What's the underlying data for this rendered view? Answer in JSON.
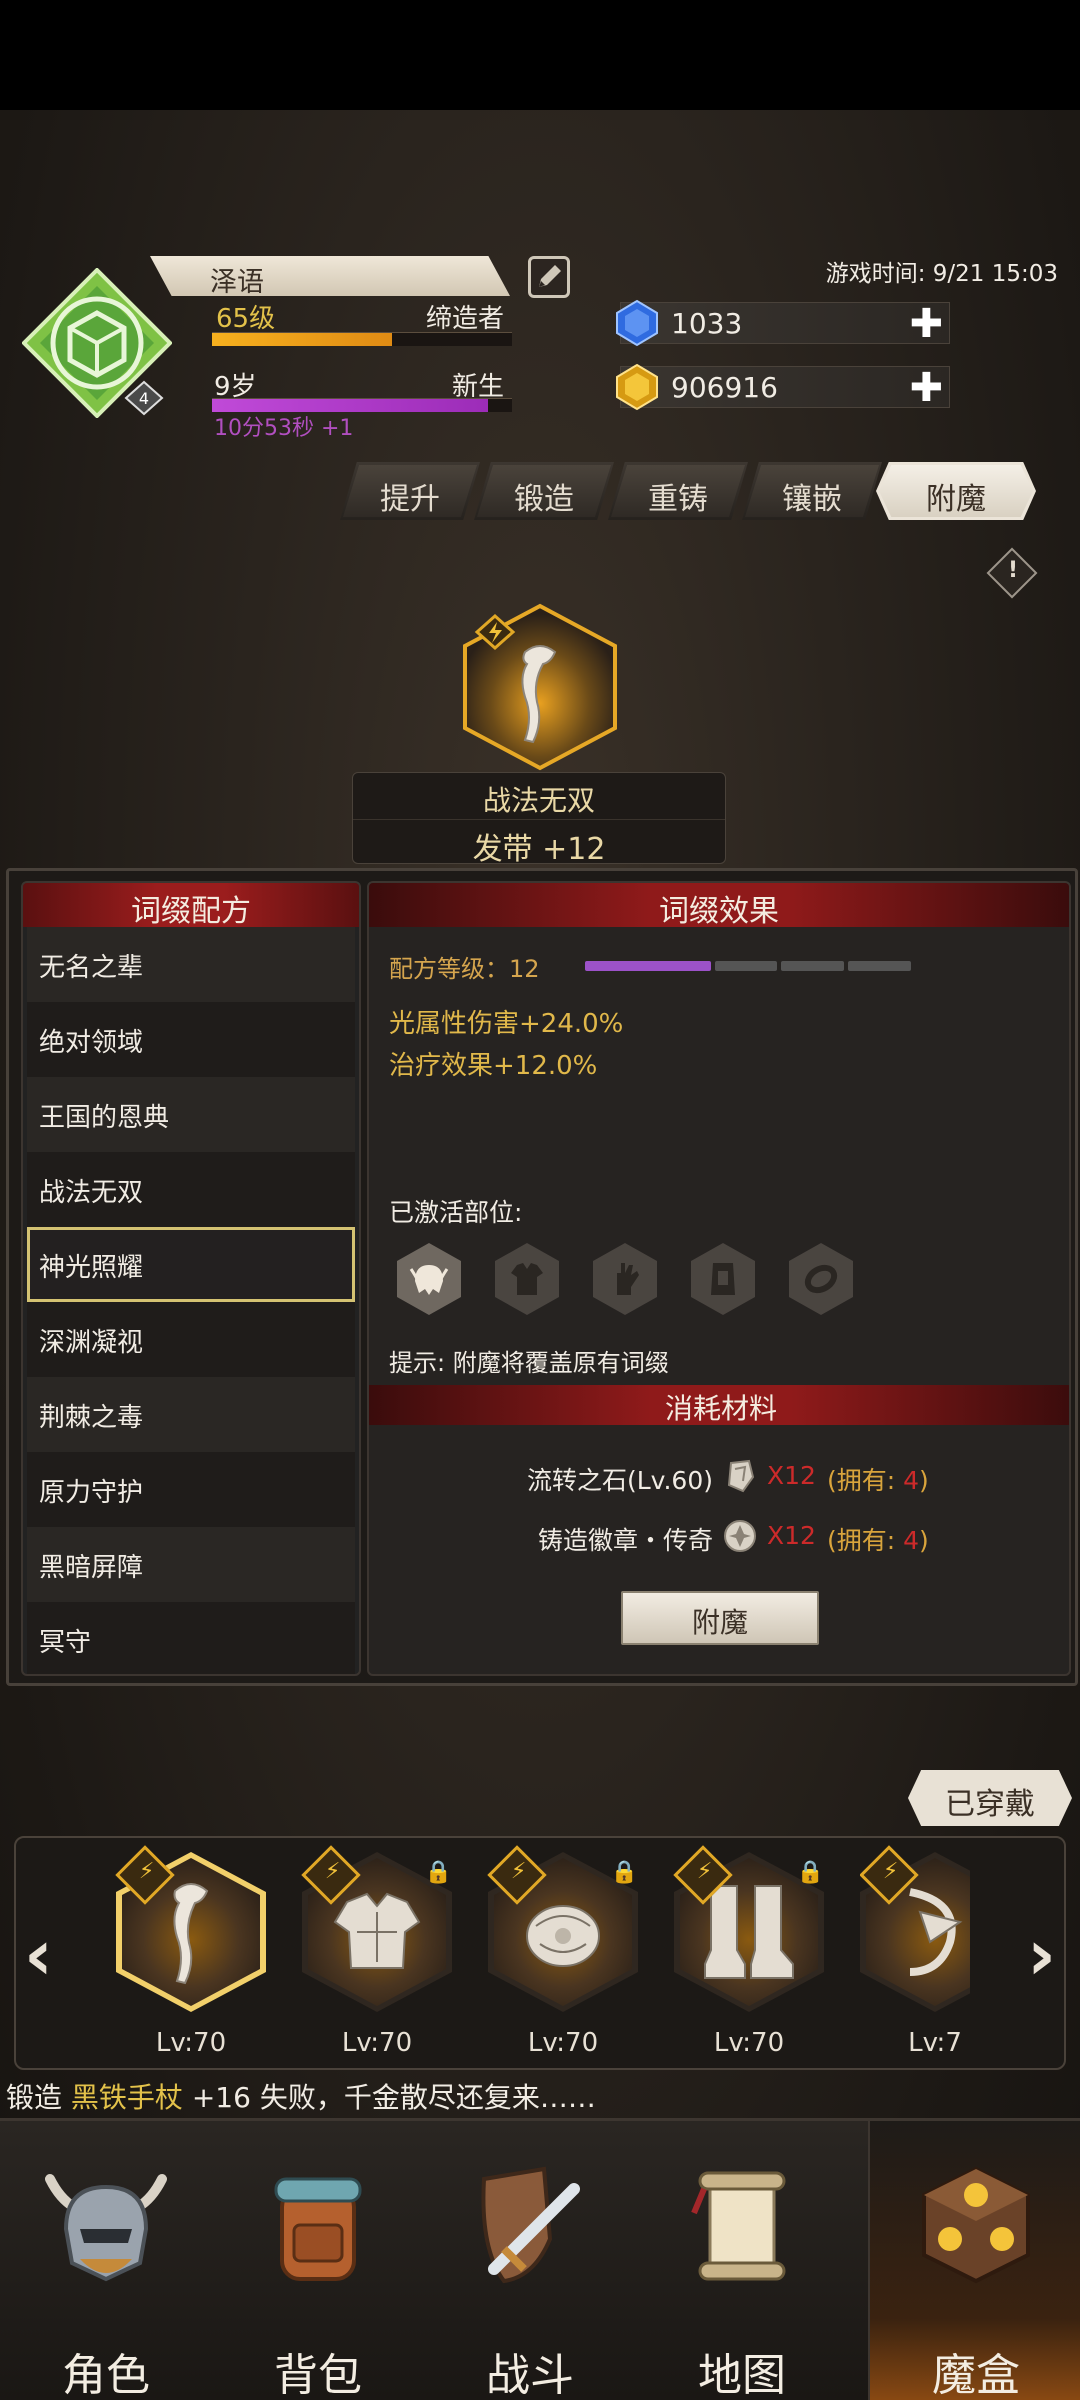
{
  "header": {
    "player_name": "泽语",
    "level": "65级",
    "title": "缔造者",
    "age": "9岁",
    "age_stage": "新生",
    "timer": "10分53秒 +1",
    "avatar_badge": "4",
    "game_time": "游戏时间: 9/21 15:03",
    "level_progress": 0.6,
    "age_progress": 0.92,
    "diamonds": "1033",
    "gold": "906916",
    "colors": {
      "level_bar": "#f0a21a",
      "age_bar": "#b23fd0",
      "accent_gold": "#e3c24a"
    }
  },
  "tabs": [
    "提升",
    "锻造",
    "重铸",
    "镶嵌",
    "附魔"
  ],
  "active_tab": "附魔",
  "info_icon": "!",
  "item": {
    "name": "战法无双",
    "slot_label": "发带 +12"
  },
  "affix_list": {
    "title": "词缀配方",
    "items": [
      "无名之辈",
      "绝对领域",
      "王国的恩典",
      "战法无双",
      "神光照耀",
      "深渊凝视",
      "荆棘之毒",
      "原力守护",
      "黑暗屏障",
      "冥守"
    ],
    "selected": "神光照耀"
  },
  "affix_effect": {
    "title": "词缀效果",
    "formula_level": "配方等级：12",
    "formula_progress": 0.4,
    "effects": [
      "光属性伤害+24.0%",
      "治疗效果+12.0%"
    ],
    "activated_label": "已激活部位:",
    "slots": [
      "helmet-icon",
      "armor-icon",
      "glove-icon",
      "belt-icon",
      "ring-icon"
    ],
    "hint": "提示: 附魔将覆盖原有词缀"
  },
  "materials": {
    "title": "消耗材料",
    "rows": [
      {
        "name": "流转之石(Lv.60)",
        "qty": "X12",
        "own_prefix": "(拥有: ",
        "own_count": "4",
        "own_suffix": ")"
      },
      {
        "name": "铸造徽章・传奇",
        "qty": "X12",
        "own_prefix": "(拥有: ",
        "own_count": "4",
        "own_suffix": ")"
      }
    ],
    "button": "附魔"
  },
  "equipped_label": "已穿戴",
  "equipment": [
    {
      "icon": "headband-icon",
      "lv": "Lv:70"
    },
    {
      "icon": "armor-icon",
      "lv": "Lv:70"
    },
    {
      "icon": "gauntlet-icon",
      "lv": "Lv:70"
    },
    {
      "icon": "boots-icon",
      "lv": "Lv:70"
    },
    {
      "icon": "bow-icon",
      "lv": "Lv:7"
    }
  ],
  "ticker": {
    "prefix": "锻造 ",
    "item": "黑铁手杖",
    "suffix": " +16 失败，千金散尽还复来……"
  },
  "nav": [
    "角色",
    "背包",
    "战斗",
    "地图",
    "魔盒"
  ],
  "active_nav": "魔盒"
}
